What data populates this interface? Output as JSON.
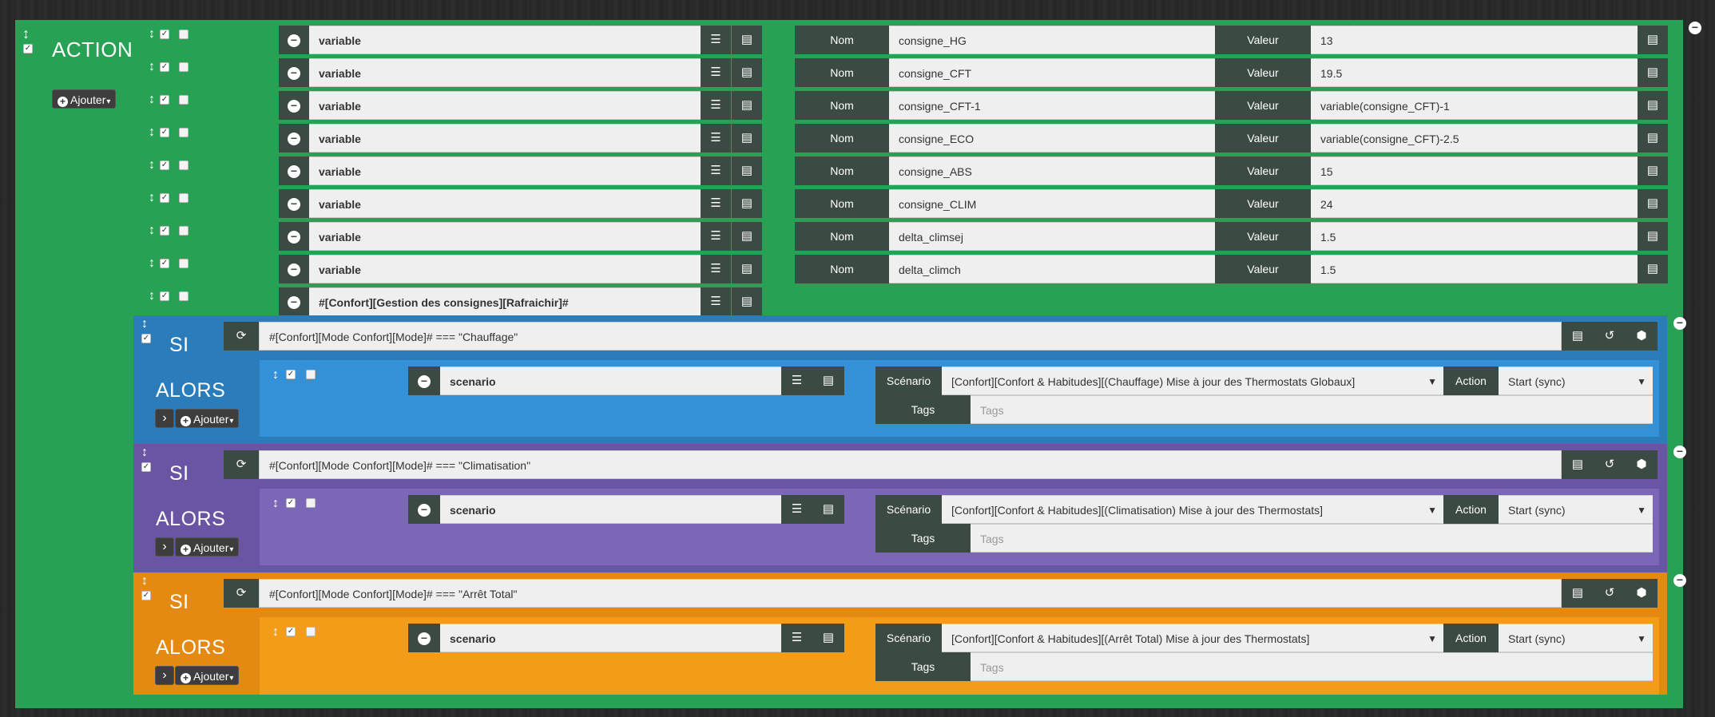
{
  "action_section": {
    "title": "ACTION",
    "add_label": "Ajouter",
    "rows": [
      {
        "cmd": "variable",
        "nom_label": "Nom",
        "nom": "consigne_HG",
        "valeur_label": "Valeur",
        "valeur": "13"
      },
      {
        "cmd": "variable",
        "nom_label": "Nom",
        "nom": "consigne_CFT",
        "valeur_label": "Valeur",
        "valeur": "19.5"
      },
      {
        "cmd": "variable",
        "nom_label": "Nom",
        "nom": "consigne_CFT-1",
        "valeur_label": "Valeur",
        "valeur": "variable(consigne_CFT)-1"
      },
      {
        "cmd": "variable",
        "nom_label": "Nom",
        "nom": "consigne_ECO",
        "valeur_label": "Valeur",
        "valeur": "variable(consigne_CFT)-2.5"
      },
      {
        "cmd": "variable",
        "nom_label": "Nom",
        "nom": "consigne_ABS",
        "valeur_label": "Valeur",
        "valeur": "15"
      },
      {
        "cmd": "variable",
        "nom_label": "Nom",
        "nom": "consigne_CLIM",
        "valeur_label": "Valeur",
        "valeur": "24"
      },
      {
        "cmd": "variable",
        "nom_label": "Nom",
        "nom": "delta_climsej",
        "valeur_label": "Valeur",
        "valeur": "1.5"
      },
      {
        "cmd": "variable",
        "nom_label": "Nom",
        "nom": "delta_climch",
        "valeur_label": "Valeur",
        "valeur": "1.5"
      }
    ],
    "last_cmd": "#[Confort][Gestion des consignes][Rafraichir]#"
  },
  "si_blocks": [
    {
      "si_label": "SI",
      "alors_label": "ALORS",
      "condition": "#[Confort][Mode Confort][Mode]# === \"Chauffage\"",
      "cmd": "scenario",
      "scenario_label": "Scénario",
      "scenario_value": "[Confort][Confort & Habitudes][(Chauffage) Mise à jour des Thermostats Globaux]",
      "action_label": "Action",
      "action_value": "Start (sync)",
      "tags_label": "Tags",
      "tags_placeholder": "Tags",
      "add_label": "Ajouter",
      "color": "#2a7cba"
    },
    {
      "si_label": "SI",
      "alors_label": "ALORS",
      "condition": "#[Confort][Mode Confort][Mode]# === \"Climatisation\"",
      "cmd": "scenario",
      "scenario_label": "Scénario",
      "scenario_value": "[Confort][Confort & Habitudes][(Climatisation) Mise à jour des Thermostats]",
      "action_label": "Action",
      "action_value": "Start (sync)",
      "tags_label": "Tags",
      "tags_placeholder": "Tags",
      "add_label": "Ajouter",
      "color": "#6a55a5"
    },
    {
      "si_label": "SI",
      "alors_label": "ALORS",
      "condition": "#[Confort][Mode Confort][Mode]# === \"Arrêt Total\"",
      "cmd": "scenario",
      "scenario_label": "Scénario",
      "scenario_value": "[Confort][Confort & Habitudes][(Arrêt Total) Mise à jour des Thermostats]",
      "action_label": "Action",
      "action_value": "Start (sync)",
      "tags_label": "Tags",
      "tags_placeholder": "Tags",
      "add_label": "Ajouter",
      "color": "#e48a12"
    }
  ],
  "icons": {
    "drag": "drag-handle-icon",
    "list": "list-icon",
    "doc": "document-icon",
    "refresh": "refresh-icon",
    "history": "history-icon",
    "cube": "cube-icon",
    "minus": "minus-circle-icon"
  }
}
